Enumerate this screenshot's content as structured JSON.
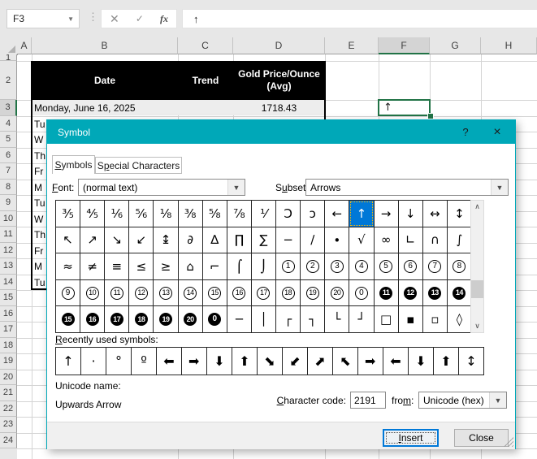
{
  "formula_bar": {
    "name_box": "F3",
    "cancel": "✕",
    "enter": "✓",
    "fx": "fx",
    "formula": "↑"
  },
  "sheet": {
    "columns": [
      "A",
      "B",
      "C",
      "D",
      "E",
      "F",
      "G",
      "H"
    ],
    "selected_column": "F",
    "rows": [
      "1",
      "2",
      "3",
      "4",
      "5",
      "6",
      "7",
      "8",
      "9",
      "10",
      "11",
      "12",
      "13",
      "14",
      "15",
      "16",
      "17",
      "18",
      "19",
      "20",
      "21",
      "22",
      "23",
      "24"
    ],
    "selected_row": "3"
  },
  "table": {
    "header": {
      "date": "Date",
      "trend": "Trend",
      "price_line1": "Gold Price/Ounce",
      "price_line2": "(Avg)"
    },
    "row3": {
      "date": "Monday, June 16, 2025",
      "trend": "",
      "price": "1718.43"
    },
    "fragments": [
      "Tu",
      "W",
      "Th",
      "Fr",
      "M",
      "Tu",
      "W",
      "Th",
      "Fr",
      "M",
      "Tu"
    ]
  },
  "selected_cell": {
    "ref": "F3",
    "value": "↑"
  },
  "dialog": {
    "title": "Symbol",
    "help": "?",
    "close_x": "×",
    "tabs": [
      {
        "label": "_S_ymbols",
        "active": true
      },
      {
        "label": "S_p_ecial Characters",
        "active": false
      }
    ],
    "font": {
      "label": "_F_ont:",
      "value": "(normal text)"
    },
    "subset": {
      "label": "S_u_bset:",
      "value": "Arrows"
    },
    "symbol_grid": {
      "selected": [
        0,
        12
      ],
      "rows": [
        [
          "⅗",
          "⅘",
          "⅙",
          "⅚",
          "⅛",
          "⅜",
          "⅝",
          "⅞",
          "⅟",
          "Ɔ",
          "ɔ",
          "←",
          "↑",
          "→",
          "↓",
          "↔",
          "↕"
        ],
        [
          "↖",
          "↗",
          "↘",
          "↙",
          "↨",
          "∂",
          "∆",
          "∏",
          "∑",
          "−",
          "∕",
          "∙",
          "√",
          "∞",
          "∟",
          "∩",
          "∫"
        ],
        [
          "≈",
          "≠",
          "≡",
          "≤",
          "≥",
          "⌂",
          "⌐",
          "⌠",
          "⌡",
          "①",
          "②",
          "③",
          "④",
          "⑤",
          "⑥",
          "⑦",
          "⑧"
        ],
        [
          "⑨",
          "⑩",
          "⑪",
          "⑫",
          "⑬",
          "⑭",
          "⑮",
          "⑯",
          "⑰",
          "⑱",
          "⑲",
          "⑳",
          "⓪",
          "⓫",
          "⓬",
          "⓭",
          "⓮"
        ],
        [
          "⓯",
          "⓰",
          "⓱",
          "⓲",
          "⓳",
          "⓴",
          "⓿",
          "─",
          "│",
          "┌",
          "┐",
          "└",
          "┘",
          "□",
          "▪",
          "▫",
          "◊"
        ]
      ]
    },
    "recent": {
      "label": "_R_ecently used symbols:",
      "symbols": [
        {
          "g": "↑"
        },
        {
          "g": "·"
        },
        {
          "g": "°"
        },
        {
          "g": "º"
        },
        {
          "g": "⬅"
        },
        {
          "g": "⬅",
          "tf": "scaleX(-1)"
        },
        {
          "g": "⬇"
        },
        {
          "g": "⬆"
        },
        {
          "g": "⬊"
        },
        {
          "g": "⬋"
        },
        {
          "g": "⬈"
        },
        {
          "g": "⬉"
        },
        {
          "g": "⬅",
          "tf": "scaleX(-1)"
        },
        {
          "g": "⬅"
        },
        {
          "g": "⬇"
        },
        {
          "g": "⬆"
        },
        {
          "g": "↕"
        }
      ]
    },
    "unicode_name": {
      "label": "Unicode name:",
      "value": "Upwards Arrow"
    },
    "char_code": {
      "label": "_C_haracter code:",
      "value": "2191"
    },
    "from": {
      "label": "fro_m_:",
      "value": "Unicode (hex)"
    },
    "buttons": {
      "insert": "_I_nsert",
      "close": "Close"
    }
  },
  "colors": {
    "excel_green": "#217346",
    "dialog_teal": "#00a8b8",
    "selection_blue": "#0078d7",
    "table_header_bg": "#000000"
  }
}
